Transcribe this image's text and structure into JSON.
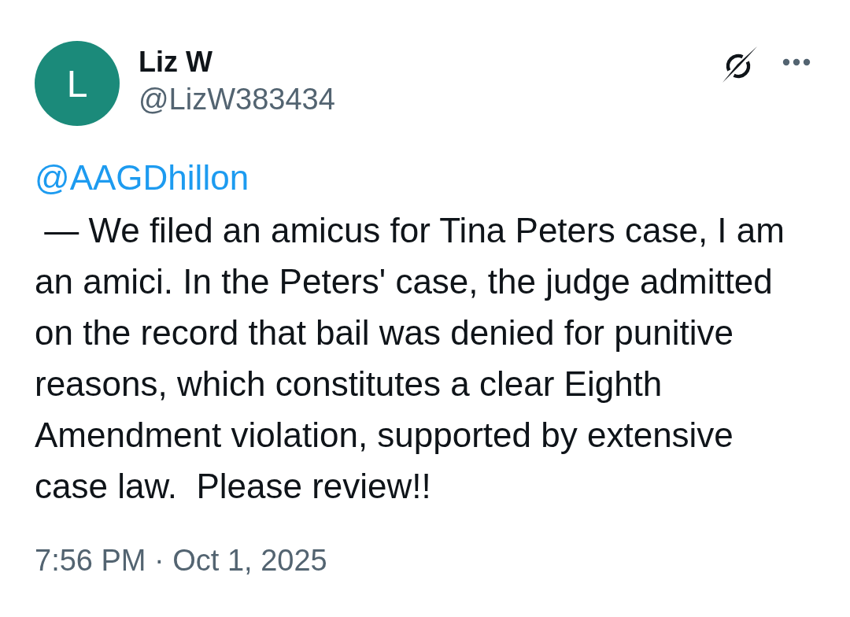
{
  "author": {
    "avatar_letter": "L",
    "name": "Liz W",
    "handle": "@LizW383434"
  },
  "post": {
    "mention": "@AAGDhillon",
    "text": " — We filed an amicus for Tina Peters case, I am an amici. In the Peters' case, the judge admitted on the record that bail was denied for punitive reasons, which constitutes a clear Eighth Amendment violation, supported by extensive case law.  Please review!!",
    "timestamp": "7:56 PM · Oct 1, 2025"
  }
}
